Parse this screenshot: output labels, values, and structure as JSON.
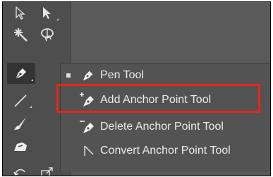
{
  "colors": {
    "toolbar_bg": "#4e4e4e",
    "flyout_bg": "#535353",
    "highlight": "#e8261a",
    "text": "#ececec"
  },
  "toolbar": {
    "tools": [
      {
        "name": "selection-tool",
        "icon": "selection-arrow-icon"
      },
      {
        "name": "direct-selection-tool",
        "icon": "direct-selection-arrow-icon"
      },
      {
        "name": "magic-wand-tool",
        "icon": "magic-wand-icon"
      },
      {
        "name": "lasso-tool",
        "icon": "lasso-icon"
      },
      {
        "name": "pen-tool",
        "icon": "pen-icon",
        "active": true
      },
      {
        "name": "line-tool",
        "icon": "line-segment-icon"
      },
      {
        "name": "paintbrush-tool",
        "icon": "paintbrush-icon"
      },
      {
        "name": "shaper-tool",
        "icon": "shaper-icon"
      },
      {
        "name": "rotate-tool",
        "icon": "rotate-icon"
      },
      {
        "name": "scale-tool",
        "icon": "scale-icon"
      }
    ]
  },
  "flyout": {
    "items": [
      {
        "label": "Pen Tool",
        "icon": "pen-icon",
        "selected": true
      },
      {
        "label": "Add Anchor Point Tool",
        "icon": "add-anchor-point-icon",
        "highlighted": true
      },
      {
        "label": "Delete Anchor Point Tool",
        "icon": "delete-anchor-point-icon"
      },
      {
        "label": "Convert Anchor Point Tool",
        "icon": "convert-anchor-point-icon"
      }
    ]
  }
}
